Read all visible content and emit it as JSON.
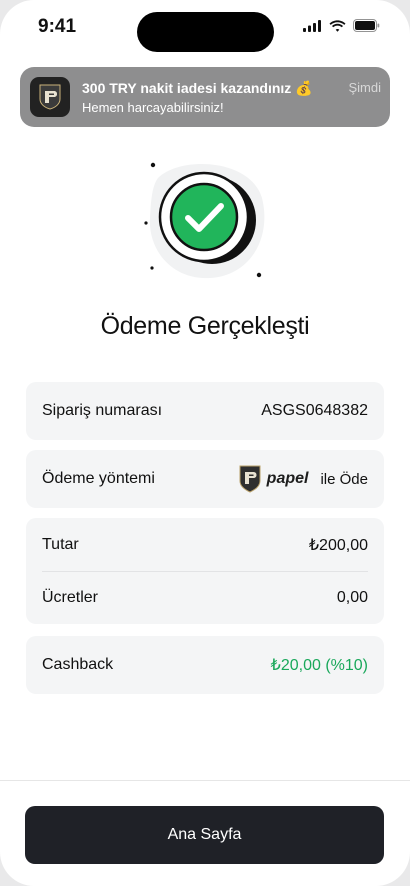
{
  "status_bar": {
    "time": "9:41"
  },
  "notification": {
    "title": "300 TRY nakit iadesi kazandınız 💰",
    "body": "Hemen harcayabilirsiniz!",
    "time": "Şimdi"
  },
  "page": {
    "title": "Ödeme Gerçekleşti"
  },
  "details": {
    "order": {
      "label": "Sipariş numarası",
      "value": "ASGS0648382"
    },
    "payment": {
      "label": "Ödeme yöntemi",
      "brand": "papel",
      "suffix": "ile Öde"
    },
    "amount": {
      "label": "Tutar",
      "value": "₺200,00"
    },
    "fees": {
      "label": "Ücretler",
      "value": "0,00"
    },
    "cashback": {
      "label": "Cashback",
      "value": "₺20,00 (%10)"
    }
  },
  "footer": {
    "home_button": "Ana Sayfa"
  },
  "colors": {
    "success": "#1aa85b",
    "button_bg": "#1f2127",
    "card_bg": "#f4f5f6"
  },
  "icons": [
    "signal-icon",
    "wifi-icon",
    "battery-icon",
    "papel-app-icon",
    "success-check-icon",
    "papel-brand-icon"
  ]
}
